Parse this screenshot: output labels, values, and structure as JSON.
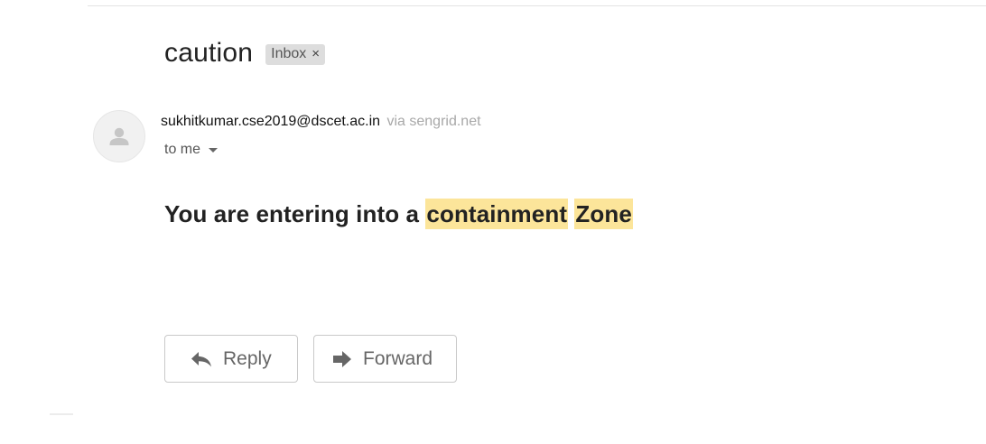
{
  "email": {
    "subject": "caution",
    "label": "Inbox",
    "label_remove_symbol": "×",
    "sender_email": "sukhitkumar.cse2019@dscet.ac.in",
    "via": "via sengrid.net",
    "recipient": "to me",
    "body": {
      "prefix": "You are entering into a ",
      "highlight_1": "containment",
      "between": " ",
      "highlight_2": "Zone"
    }
  },
  "actions": {
    "reply_label": "Reply",
    "forward_label": "Forward"
  },
  "icons": {
    "avatar": "person-icon",
    "recipient_dropdown": "caret-down-icon",
    "reply": "reply-arrow-icon",
    "forward": "forward-arrow-icon",
    "label_remove": "close-icon"
  },
  "colors": {
    "highlight": "#fce59a",
    "label_chip": "#dddddd",
    "text_primary": "#222222",
    "text_secondary": "#555555",
    "via_text": "#a8a8a8",
    "button_border": "#c9c9c9"
  }
}
